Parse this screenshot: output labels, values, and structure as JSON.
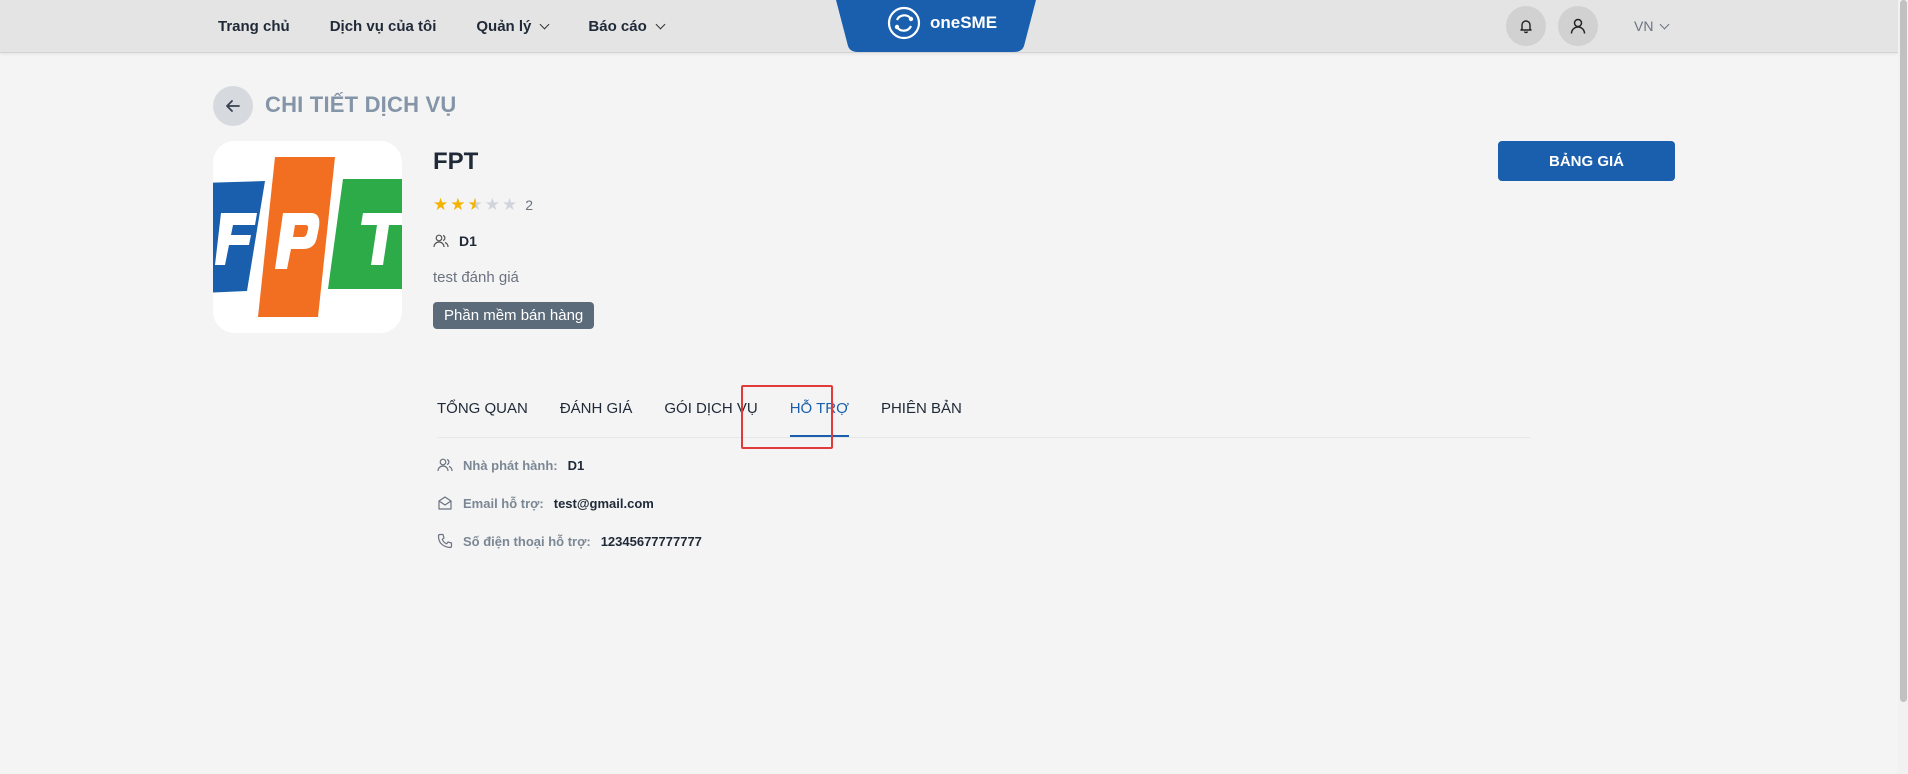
{
  "nav": {
    "items": [
      {
        "label": "Trang chủ",
        "dropdown": false
      },
      {
        "label": "Dịch vụ của tôi",
        "dropdown": false
      },
      {
        "label": "Quản lý",
        "dropdown": true
      },
      {
        "label": "Báo cáo",
        "dropdown": true
      }
    ],
    "brand": "oneSME",
    "language": "VN"
  },
  "icons": {
    "bell": "bell-icon",
    "user": "user-icon",
    "back": "arrow-left-icon",
    "publisher": "users-icon",
    "email": "mail-open-icon",
    "phone": "phone-icon"
  },
  "colors": {
    "primary": "#1a5fad",
    "title": "#8595a8",
    "star_filled": "#f5b301",
    "star_empty": "#d1d5db",
    "tag_bg": "#5b6b79",
    "highlight": "#e03a3a"
  },
  "page": {
    "title": "CHI TIẾT DỊCH VỤ"
  },
  "service": {
    "name": "FPT",
    "rating": 2.5,
    "rating_max": 5,
    "rating_count": "2",
    "publisher": "D1",
    "description": "test đánh giá",
    "tag": "Phần mềm bán hàng",
    "price_button": "BẢNG GIÁ"
  },
  "tabs": [
    {
      "label": "TỔNG QUAN",
      "active": false
    },
    {
      "label": "ĐÁNH GIÁ",
      "active": false
    },
    {
      "label": "GÓI DỊCH VỤ",
      "active": false
    },
    {
      "label": "HỖ TRỢ",
      "active": true
    },
    {
      "label": "PHIÊN BẢN",
      "active": false
    }
  ],
  "support": {
    "publisher_label": "Nhà phát hành:",
    "publisher_value": "D1",
    "email_label": "Email hỗ trợ:",
    "email_value": "test@gmail.com",
    "phone_label": "Số điện thoại hỗ trợ:",
    "phone_value": "12345677777777"
  }
}
